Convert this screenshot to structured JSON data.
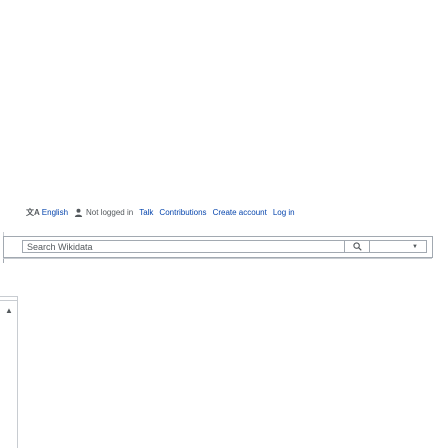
{
  "personal": {
    "language": "English",
    "status": "Not logged in",
    "talk": "Talk",
    "contributions": "Contributions",
    "create_account": "Create account",
    "login": "Log in"
  },
  "search": {
    "placeholder": "Search Wikidata"
  },
  "icons": {
    "language": "translate-icon",
    "user": "user-icon",
    "search": "search-icon",
    "dropdown": "chevron-down-icon",
    "collapse": "chevron-up-icon"
  },
  "colors": {
    "link": "#0645ad",
    "muted": "#54595d",
    "border": "#a2a9b1"
  }
}
